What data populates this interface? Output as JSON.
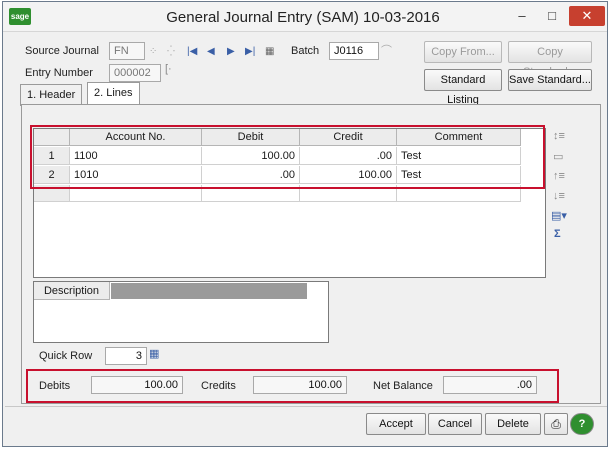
{
  "window": {
    "title": "General Journal Entry (SAM) 10-03-2016",
    "logo_text": "sage",
    "controls": {
      "minimize": "–",
      "maximize": "□",
      "close": "✕"
    }
  },
  "header": {
    "source_journal_label": "Source Journal",
    "source_journal_value": "FN",
    "entry_number_label": "Entry Number",
    "entry_number_value": "000002",
    "batch_label": "Batch",
    "batch_value": "J0116",
    "buttons": {
      "copy_from": "Copy From...",
      "copy_standard": "Copy Standard...",
      "standard_listing": "Standard Listing",
      "save_standard": "Save Standard..."
    }
  },
  "tabs": [
    {
      "label": "1. Header",
      "active": false
    },
    {
      "label": "2. Lines",
      "active": true
    }
  ],
  "grid": {
    "columns": [
      "Account No.",
      "Debit",
      "Credit",
      "Comment"
    ],
    "rows": [
      {
        "num": "1",
        "account": "1100",
        "debit": "100.00",
        "credit": ".00",
        "comment": "Test"
      },
      {
        "num": "2",
        "account": "1010",
        "debit": ".00",
        "credit": "100.00",
        "comment": "Test"
      }
    ]
  },
  "description": {
    "label": "Description"
  },
  "quick_row": {
    "label": "Quick Row",
    "value": "3"
  },
  "totals": {
    "debits_label": "Debits",
    "debits_value": "100.00",
    "credits_label": "Credits",
    "credits_value": "100.00",
    "net_balance_label": "Net Balance",
    "net_balance_value": ".00"
  },
  "footer": {
    "accept": "Accept",
    "cancel": "Cancel",
    "delete": "Delete",
    "print_icon": "printer-icon",
    "help_icon": "help-icon"
  },
  "colors": {
    "highlight": "#c8102e",
    "help_green": "#2f8f2f",
    "close_red": "#c7402f"
  }
}
